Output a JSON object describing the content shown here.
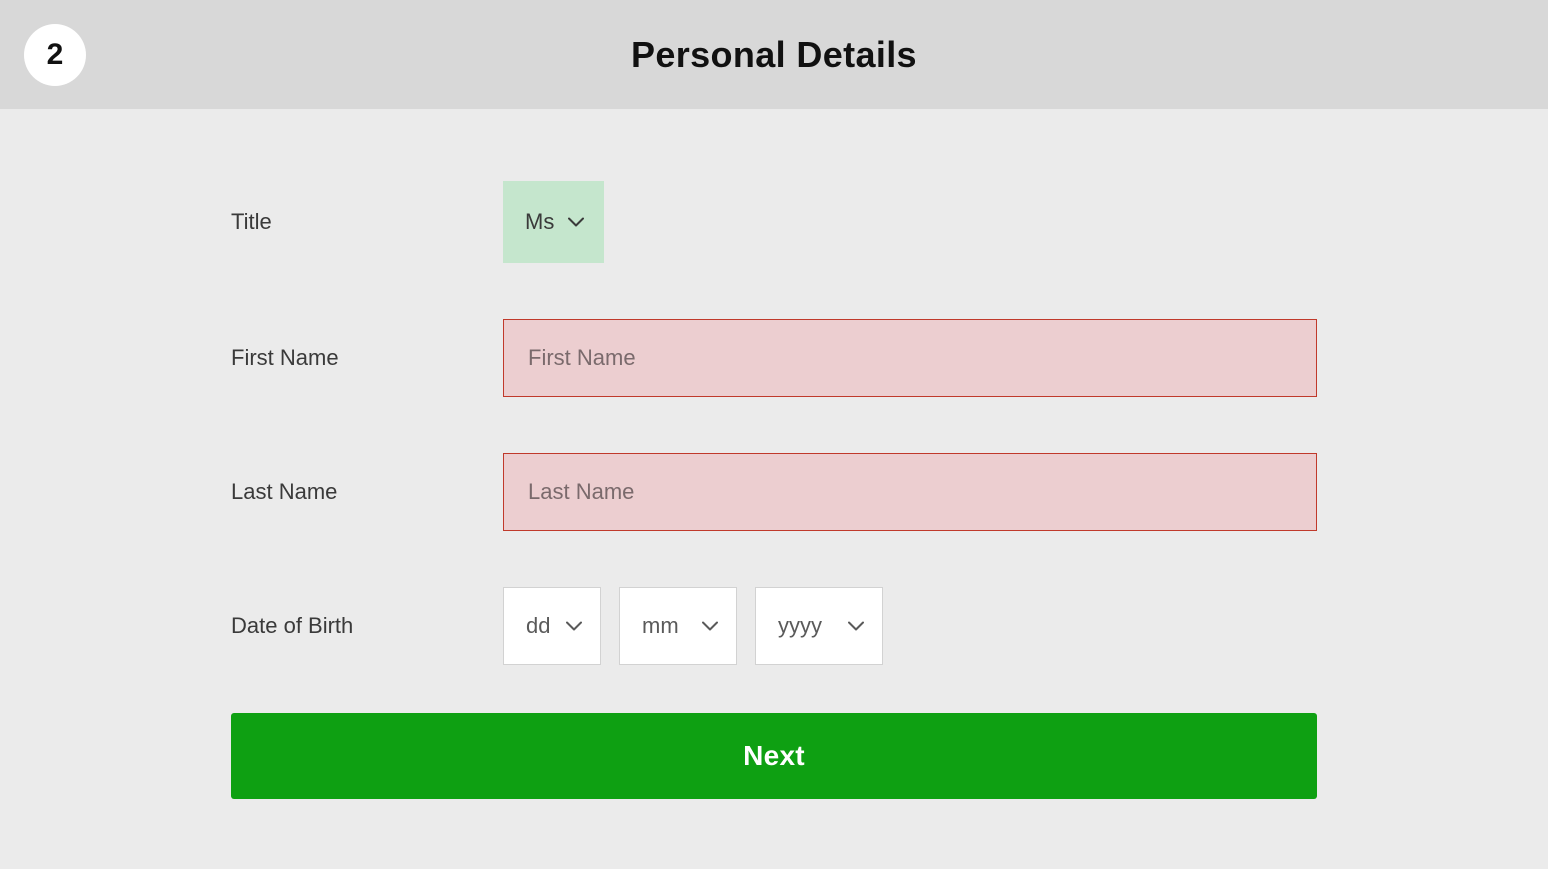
{
  "header": {
    "step_number": "2",
    "title": "Personal Details"
  },
  "form": {
    "title": {
      "label": "Title",
      "value": "Ms"
    },
    "first_name": {
      "label": "First Name",
      "placeholder": "First Name",
      "value": ""
    },
    "last_name": {
      "label": "Last Name",
      "placeholder": "Last Name",
      "value": ""
    },
    "dob": {
      "label": "Date of Birth",
      "day": "dd",
      "month": "mm",
      "year": "yyyy"
    },
    "next_label": "Next"
  }
}
